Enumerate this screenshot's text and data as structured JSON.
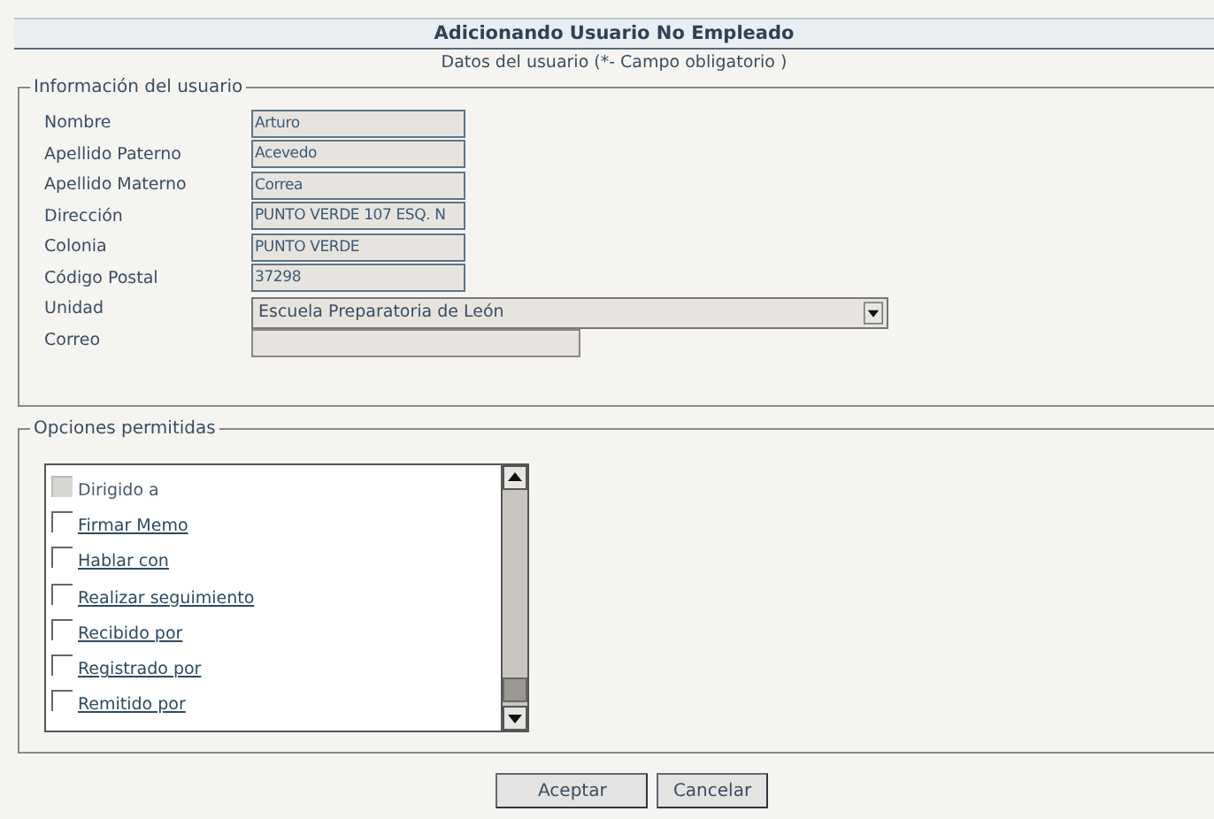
{
  "title": "Adicionando Usuario No Empleado",
  "subtitle": "Datos del usuario (*- Campo obligatorio )",
  "user_info": {
    "legend": "Información del usuario",
    "fields": [
      {
        "label": "Nombre",
        "kind": "text",
        "value": "Arturo"
      },
      {
        "label": "Apellido Paterno",
        "kind": "text",
        "value": "Acevedo"
      },
      {
        "label": "Apellido Materno",
        "kind": "text",
        "value": "Correa"
      },
      {
        "label": "Dirección",
        "kind": "text",
        "value": "PUNTO VERDE 107 ESQ. N"
      },
      {
        "label": "Colonia",
        "kind": "text",
        "value": "PUNTO VERDE"
      },
      {
        "label": "Código Postal",
        "kind": "text",
        "value": "37298"
      },
      {
        "label": "Unidad",
        "kind": "select",
        "value": "Escuela Preparatoria de León"
      },
      {
        "label": "Correo",
        "kind": "wide"
      }
    ]
  },
  "options": {
    "legend": "Opciones permitidas",
    "items": [
      {
        "label": "Dirigido a",
        "checked": false,
        "disabled": true
      },
      {
        "label": "Firmar Memo",
        "checked": false,
        "disabled": false
      },
      {
        "label": "Hablar con",
        "checked": false,
        "disabled": false
      },
      {
        "label": "Realizar seguimiento",
        "checked": false,
        "disabled": false
      },
      {
        "label": "Recibido por",
        "checked": false,
        "disabled": false
      },
      {
        "label": "Registrado por",
        "checked": false,
        "disabled": false
      },
      {
        "label": "Remitido por",
        "checked": false,
        "disabled": false
      }
    ]
  },
  "buttons": [
    "Aceptar",
    "Cancelar"
  ]
}
